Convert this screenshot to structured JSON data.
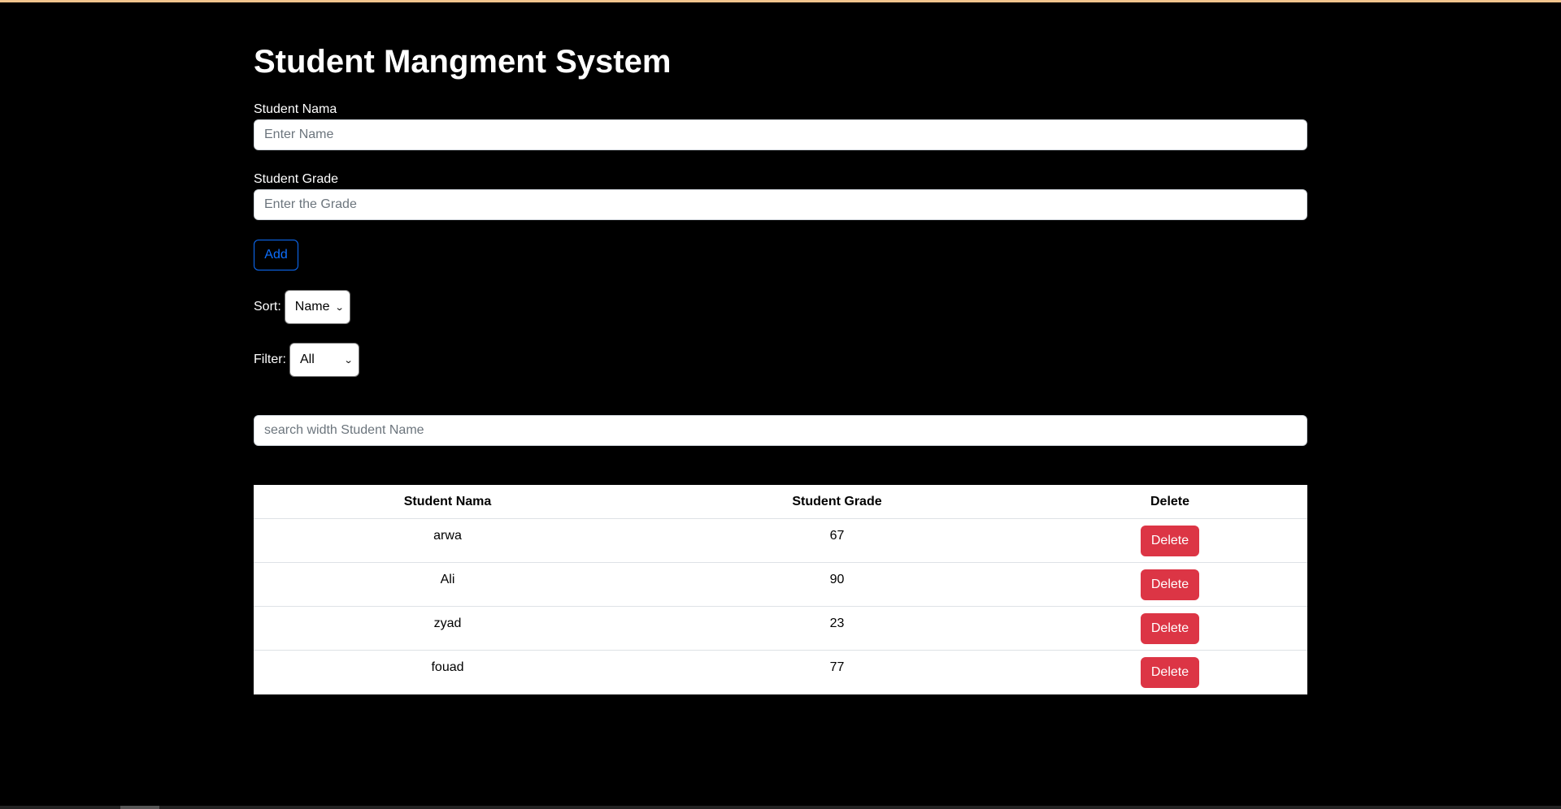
{
  "app": {
    "title": "Student Mangment System"
  },
  "form": {
    "name_label": "Student Nama",
    "name_placeholder": "Enter Name",
    "name_value": "",
    "grade_label": "Student Grade",
    "grade_placeholder": "Enter the Grade",
    "grade_value": "",
    "add_label": "Add"
  },
  "controls": {
    "sort_label": "Sort:",
    "sort_selected": "Name",
    "filter_label": "Filter:",
    "filter_selected": "All"
  },
  "search": {
    "placeholder": "search width Student Name",
    "value": ""
  },
  "table": {
    "headers": [
      "Student Nama",
      "Student Grade",
      "Delete"
    ],
    "rows": [
      {
        "name": "arwa",
        "grade": "67",
        "action": "Delete"
      },
      {
        "name": "Ali",
        "grade": "90",
        "action": "Delete"
      },
      {
        "name": "zyad",
        "grade": "23",
        "action": "Delete"
      },
      {
        "name": "fouad",
        "grade": "77",
        "action": "Delete"
      }
    ]
  },
  "colors": {
    "background": "#000000",
    "accent": "#0d6efd",
    "danger": "#dc3545",
    "top_strip": "#f2c48d"
  },
  "icons": {
    "select_arrow": "chevron-down-icon"
  }
}
